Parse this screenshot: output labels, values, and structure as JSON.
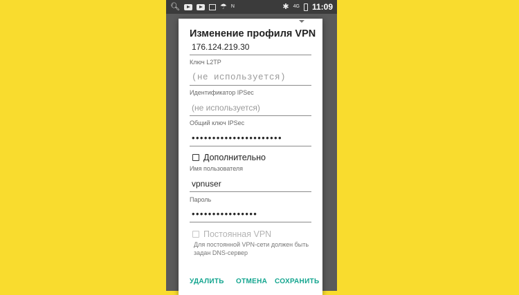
{
  "statusbar": {
    "left_icons": [
      "search-icon",
      "youtube-icon",
      "youtube-icon",
      "image-icon",
      "umbrella-icon",
      "nfc-icon"
    ],
    "right_icons": [
      "bluetooth-icon",
      "signal-4g-icon",
      "battery-icon"
    ],
    "time": "11:09"
  },
  "dialog": {
    "title": "Изменение профиля VPN",
    "server_value": "176.124.219.30",
    "l2tp": {
      "label": "Ключ L2TP",
      "placeholder": "(не используется)"
    },
    "ipsec_id": {
      "label": "Идентификатор IPSec",
      "placeholder": "(не используется)"
    },
    "ipsec_key": {
      "label": "Общий ключ IPSec",
      "value": "••••••••••••••••••••••"
    },
    "advanced": {
      "label": "Дополнительно",
      "checked": false
    },
    "username": {
      "label": "Имя пользователя",
      "value": "vpnuser"
    },
    "password": {
      "label": "Пароль",
      "value": "••••••••••••••••"
    },
    "always_on": {
      "label": "Постоянная VPN",
      "enabled": false,
      "checked": false
    },
    "hint": "Для постоянной VPN-сети должен быть задан DNS-сервер",
    "buttons": {
      "delete": "УДАЛИТЬ",
      "cancel": "ОТМЕНА",
      "save": "СОХРАНИТЬ"
    }
  },
  "colors": {
    "background": "#f9dc2e",
    "accent": "#13a58f"
  }
}
